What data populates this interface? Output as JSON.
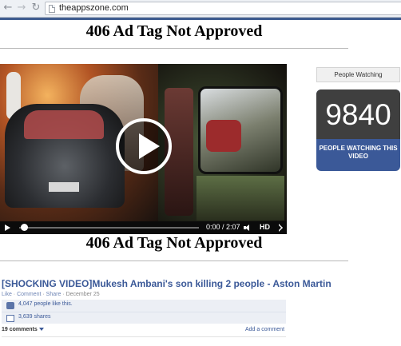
{
  "browser": {
    "url": "theappszone.com",
    "back_icon": "arrow-left-icon",
    "forward_icon": "arrow-right-icon",
    "reload_icon": "reload-icon"
  },
  "ad_tag_top": "406 Ad Tag Not Approved",
  "ad_tag_bottom": "406 Ad Tag Not Approved",
  "video": {
    "time": "0:00 / 2:07",
    "hd_label": "HD",
    "progress": 0.0
  },
  "sidebar": {
    "people_watching_label": "People Watching",
    "count": "9840",
    "caption": "PEOPLE WATCHING THIS VIDEO"
  },
  "post": {
    "title": "[SHOCKING VIDEO]Mukesh Ambani's son killing 2 people - Aston Martin",
    "actions": [
      "Like",
      "Comment",
      "Share"
    ],
    "date": "December 25",
    "likes_text": "4,047 people like this.",
    "shares_text": "3,639 shares",
    "comments_text": "19 comments",
    "add_comment": "Add a comment"
  },
  "colors": {
    "facebook_blue": "#3b5998",
    "counter_dark": "#3f3f3f"
  }
}
